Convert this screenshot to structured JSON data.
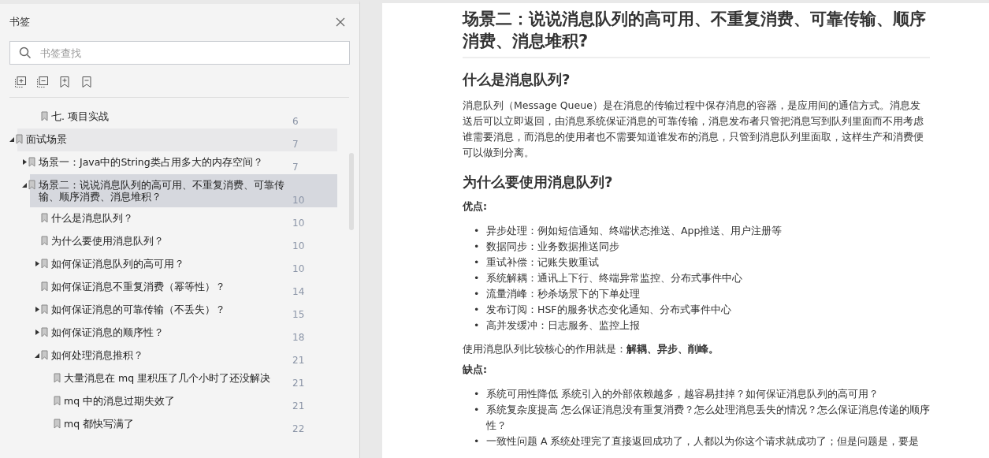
{
  "sidebar": {
    "title": "书签",
    "search": {
      "placeholder": "书签查找"
    },
    "above": [
      {
        "label": "七. 项目实战",
        "page": "6",
        "selected": false,
        "hovered": false
      }
    ],
    "items": [
      {
        "label": "面试场景",
        "page": "7",
        "expanded": true,
        "selected": false,
        "hovered": true,
        "children": [
          {
            "label": "场景一：Java中的String类占用多大的内存空间？",
            "page": "7",
            "expanded": false,
            "selected": false,
            "hovered": false
          },
          {
            "label": "场景二：说说消息队列的高可用、不重复消费、可靠传输、顺序消费、消息堆积？",
            "page": "10",
            "expanded": true,
            "selected": true,
            "hovered": false,
            "children": [
              {
                "label": "什么是消息队列？",
                "page": "10",
                "selected": false,
                "hovered": false
              },
              {
                "label": "为什么要使用消息队列？",
                "page": "10",
                "selected": false,
                "hovered": false
              },
              {
                "label": "如何保证消息队列的高可用？",
                "page": "10",
                "expanded": false,
                "selected": false,
                "hovered": false
              },
              {
                "label": "如何保证消息不重复消费（幂等性）？",
                "page": "14",
                "selected": false,
                "hovered": false
              },
              {
                "label": "如何保证消息的可靠传输（不丢失）？",
                "page": "15",
                "expanded": false,
                "selected": false,
                "hovered": false
              },
              {
                "label": "如何保证消息的顺序性？",
                "page": "18",
                "expanded": false,
                "selected": false,
                "hovered": false
              },
              {
                "label": "如何处理消息推积？",
                "page": "21",
                "expanded": true,
                "selected": false,
                "hovered": false,
                "children": [
                  {
                    "label": "大量消息在 mq 里积压了几个小时了还没解决",
                    "page": "21",
                    "selected": false,
                    "hovered": false
                  },
                  {
                    "label": "mq 中的消息过期失效了",
                    "page": "21",
                    "selected": false,
                    "hovered": false
                  },
                  {
                    "label": "mq 都快写满了",
                    "page": "22",
                    "selected": false,
                    "hovered": false
                  }
                ]
              }
            ]
          }
        ]
      }
    ]
  },
  "document": [
    {
      "kind": "h1",
      "text": "场景二：说说消息队列的高可用、不重复消费、可靠传输、顺序消费、消息堆积?"
    },
    {
      "kind": "h2",
      "text": "什么是消息队列?"
    },
    {
      "kind": "p",
      "text": "消息队列（Message Queue）是在消息的传输过程中保存消息的容器，是应用间的通信方式。消息发送后可以立即返回，由消息系统保证消息的可靠传输，消息发布者只管把消息写到队列里面而不用考虑谁需要消息，而消息的使用者也不需要知道谁发布的消息，只管到消息队列里面取，这样生产和消费便可以做到分离。"
    },
    {
      "kind": "h2",
      "text": "为什么要使用消息队列?"
    },
    {
      "kind": "label",
      "text": "优点:"
    },
    {
      "kind": "list",
      "items": [
        {
          "marker": "•",
          "text": "异步处理：例如短信通知、终端状态推送、App推送、用户注册等"
        },
        {
          "marker": "•",
          "text": "数据同步：业务数据推送同步"
        },
        {
          "marker": "•",
          "text": "重试补偿：记账失败重试"
        },
        {
          "marker": "•",
          "text": "系统解耦：通讯上下行、终端异常监控、分布式事件中心"
        },
        {
          "marker": "•",
          "text": "流量消峰：秒杀场景下的下单处理"
        },
        {
          "marker": "•",
          "text": "发布订阅：HSF的服务状态变化通知、分布式事件中心"
        },
        {
          "marker": "•",
          "text": "高并发缓冲：日志服务、监控上报"
        }
      ]
    },
    {
      "kind": "p",
      "text": "使用消息队列比较核心的作用就是：**解耦、异步、削峰。**"
    },
    {
      "kind": "label",
      "text": "缺点:"
    },
    {
      "kind": "list",
      "items": [
        {
          "marker": "•",
          "text": "系统可用性降低 系统引入的外部依赖越多，越容易挂掉？如何保证消息队列的高可用？"
        },
        {
          "marker": "•",
          "text": "系统复杂度提高 怎么保证消息没有重复消费？怎么处理消息丢失的情况？怎么保证消息传递的顺序性？"
        },
        {
          "marker": "•",
          "text": "一致性问题 A 系统处理完了直接返回成功了，人都以为你这个请求就成功了；但是问题是，要是"
        }
      ]
    }
  ]
}
